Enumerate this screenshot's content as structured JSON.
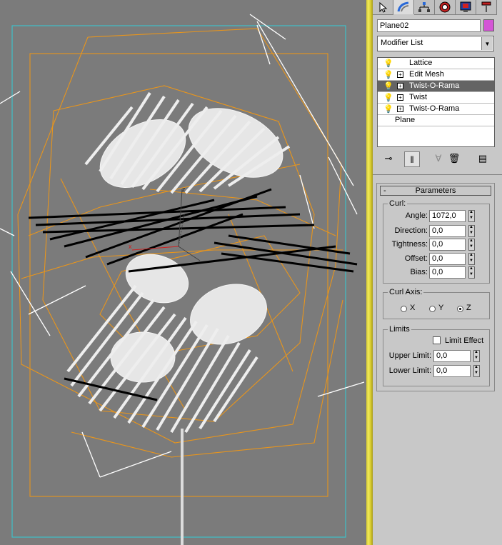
{
  "command_panel": {
    "tabs": [
      {
        "name": "create-tab",
        "icon": "cursor-arrow-icon"
      },
      {
        "name": "modify-tab",
        "icon": "modify-arc-icon"
      },
      {
        "name": "hierarchy-tab",
        "icon": "hierarchy-icon"
      },
      {
        "name": "motion-tab",
        "icon": "motion-icon"
      },
      {
        "name": "display-tab",
        "icon": "display-monitor-icon"
      },
      {
        "name": "utilities-tab",
        "icon": "hammer-icon"
      }
    ],
    "object_name": "Plane02",
    "object_color": "#d455d6",
    "modifier_list_label": "Modifier List"
  },
  "modifier_stack": [
    {
      "label": "Lattice",
      "expandable": false,
      "selected": false
    },
    {
      "label": "Edit Mesh",
      "expandable": true,
      "selected": false
    },
    {
      "label": "Twist-O-Rama",
      "expandable": true,
      "selected": true
    },
    {
      "label": "Twist",
      "expandable": true,
      "selected": false
    },
    {
      "label": "Twist-O-Rama",
      "expandable": true,
      "selected": false
    },
    {
      "label": "Plane",
      "expandable": false,
      "selected": false
    }
  ],
  "stack_tools": [
    "pin-stack-icon",
    "show-end-result-icon",
    "make-unique-icon",
    "remove-modifier-icon",
    "configure-sets-icon"
  ],
  "parameters": {
    "title": "Parameters",
    "collapse_sign": "-",
    "curl": {
      "label": "Curl:",
      "rows": [
        {
          "label": "Angle:",
          "value": "1072,0"
        },
        {
          "label": "Direction:",
          "value": "0,0"
        },
        {
          "label": "Tightness:",
          "value": "0,0"
        },
        {
          "label": "Offset:",
          "value": "0,0"
        },
        {
          "label": "Bias:",
          "value": "0,0"
        }
      ]
    },
    "curl_axis": {
      "label": "Curl Axis:",
      "options": [
        {
          "label": "X",
          "selected": false
        },
        {
          "label": "Y",
          "selected": false
        },
        {
          "label": "Z",
          "selected": true
        }
      ]
    },
    "limits": {
      "label": "Limits",
      "limit_effect_label": "Limit Effect",
      "limit_effect_checked": false,
      "upper_limit_label": "Upper Limit:",
      "upper_limit_value": "0,0",
      "lower_limit_label": "Lower Limit:",
      "lower_limit_value": "0,0"
    }
  },
  "viewport": {
    "gizmo_label": "x",
    "axis_z": "z",
    "background": "#7b7b7b",
    "wire_color": "#e8951c",
    "safe_frame_color": "#3fc0c8",
    "selected_mesh_color": "#ececec",
    "lattice_dark_color": "#000000"
  }
}
